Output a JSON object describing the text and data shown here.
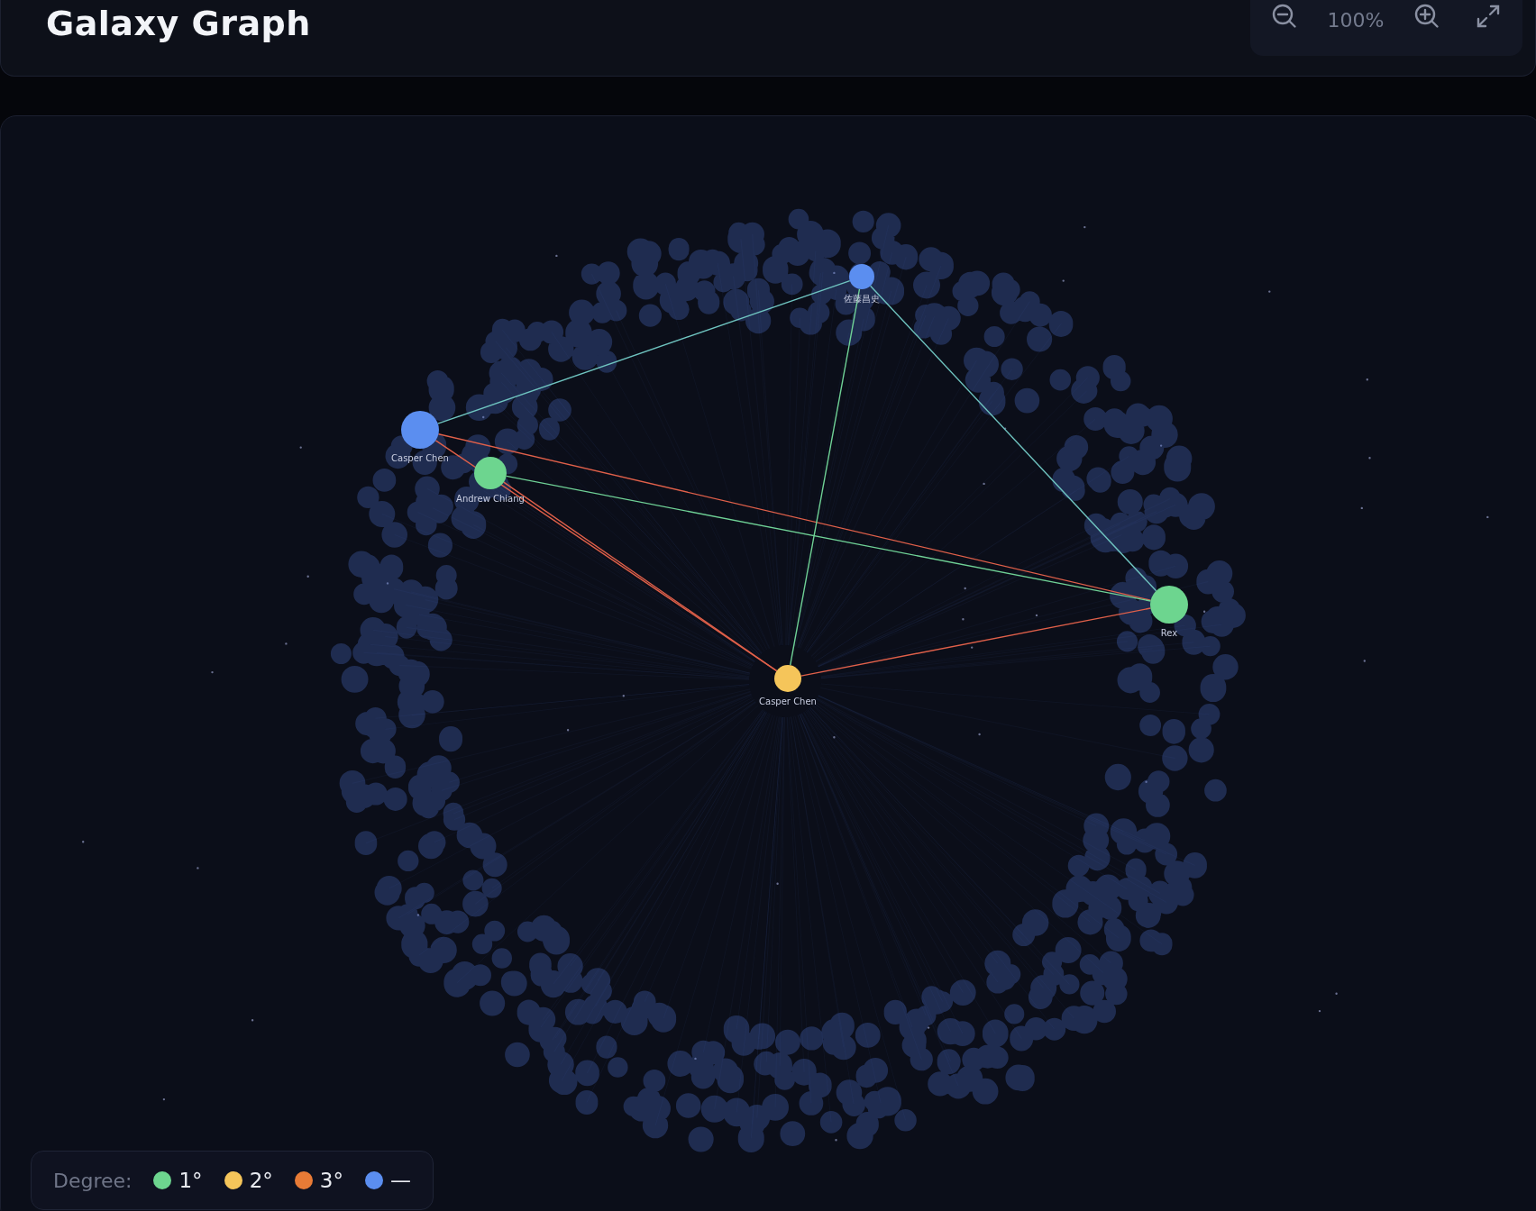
{
  "header": {
    "title": "Galaxy Graph",
    "zoom_level": "100%"
  },
  "graph": {
    "nodes": [
      {
        "label": "Casper Chen",
        "color": "#5b8ef0"
      },
      {
        "label": "Andrew Chiang",
        "color": "#6dd58f"
      },
      {
        "label": "佐藤昌史",
        "color": "#5b8ef0"
      },
      {
        "label": "Rex",
        "color": "#6dd58f"
      },
      {
        "label": "Casper Chen",
        "color": "#f5c55a"
      }
    ],
    "edges": [
      {
        "color": "#e0604a"
      },
      {
        "color": "#e0604a"
      },
      {
        "color": "#e0604a"
      },
      {
        "color": "#6fd196"
      },
      {
        "color": "#6fc4c0"
      },
      {
        "color": "#6fd196"
      },
      {
        "color": "#6fc4c0"
      },
      {
        "color": "#e0604a"
      }
    ]
  },
  "legend": {
    "label": "Degree:",
    "items": [
      {
        "label": "1°",
        "color": "#6dd58f"
      },
      {
        "label": "2°",
        "color": "#f5c55a"
      },
      {
        "label": "3°",
        "color": "#e87b36"
      },
      {
        "label": "—",
        "color": "#5b8ef0"
      }
    ]
  }
}
